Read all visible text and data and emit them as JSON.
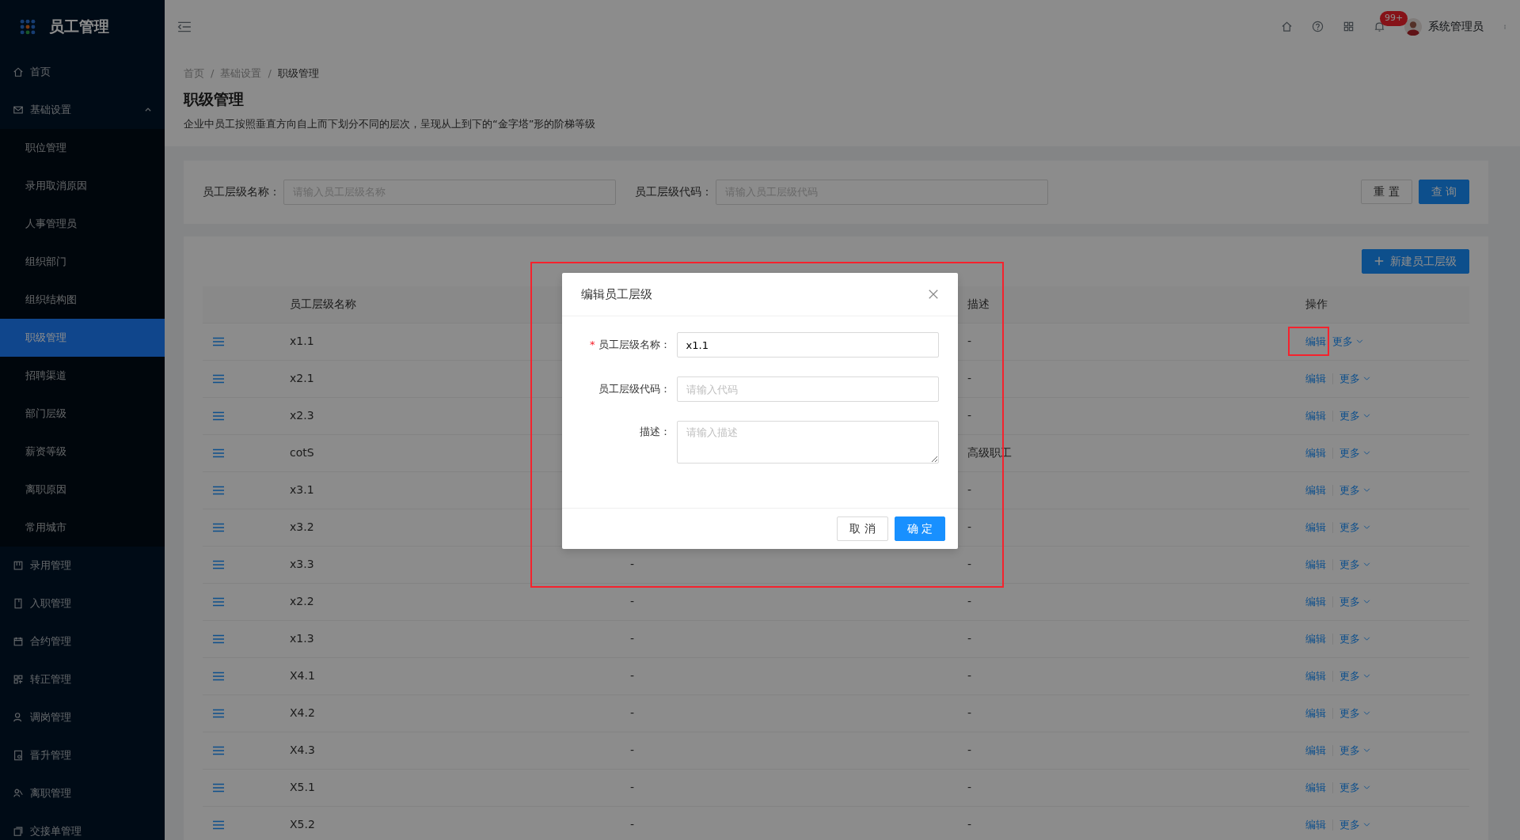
{
  "app": {
    "title": "员工管理"
  },
  "sidebar": {
    "items": [
      {
        "label": "首页",
        "kind": "link",
        "selected": false
      },
      {
        "label": "基础设置",
        "kind": "group",
        "expanded": true,
        "children": [
          {
            "label": "职位管理",
            "selected": false
          },
          {
            "label": "录用取消原因",
            "selected": false
          },
          {
            "label": "人事管理员",
            "selected": false
          },
          {
            "label": "组织部门",
            "selected": false
          },
          {
            "label": "组织结构图",
            "selected": false
          },
          {
            "label": "职级管理",
            "selected": true
          },
          {
            "label": "招聘渠道",
            "selected": false
          },
          {
            "label": "部门层级",
            "selected": false
          },
          {
            "label": "薪资等级",
            "selected": false
          },
          {
            "label": "离职原因",
            "selected": false
          },
          {
            "label": "常用城市",
            "selected": false
          }
        ]
      },
      {
        "label": "录用管理",
        "kind": "link",
        "selected": false
      },
      {
        "label": "入职管理",
        "kind": "link",
        "selected": false
      },
      {
        "label": "合约管理",
        "kind": "link",
        "selected": false
      },
      {
        "label": "转正管理",
        "kind": "link",
        "selected": false
      },
      {
        "label": "调岗管理",
        "kind": "link",
        "selected": false
      },
      {
        "label": "晋升管理",
        "kind": "link",
        "selected": false
      },
      {
        "label": "离职管理",
        "kind": "link",
        "selected": false
      },
      {
        "label": "交接单管理",
        "kind": "link",
        "selected": false
      }
    ]
  },
  "header": {
    "notification_badge": "99+",
    "user": "系统管理员"
  },
  "breadcrumb_separator": "/",
  "breadcrumb": [
    {
      "label": "首页",
      "selected": false
    },
    {
      "label": "基础设置",
      "selected": false
    },
    {
      "label": "职级管理",
      "selected": true
    }
  ],
  "page": {
    "title": "职级管理",
    "description": "企业中员工按照垂直方向自上而下划分不同的层次，呈现从上到下的“金字塔”形的阶梯等级"
  },
  "filters": [
    {
      "label": "员工层级名称：",
      "placeholder": "请输入员工层级名称"
    },
    {
      "label": "员工层级代码：",
      "placeholder": "请输入员工层级代码"
    }
  ],
  "filter_buttons": [
    {
      "label": "重 置",
      "kind": "default"
    },
    {
      "label": "查 询",
      "kind": "primary"
    }
  ],
  "new_button": {
    "label": "新建员工层级"
  },
  "table": {
    "columns": {
      "name": "员工层级名称",
      "description": "描述",
      "actions": "操作"
    },
    "rows": [
      {
        "name": "x1.1",
        "description": "-",
        "actions": [
          "编辑",
          "更多"
        ],
        "highlighted": true
      },
      {
        "name": "x2.1",
        "description": "-",
        "actions": [
          "编辑",
          "更多"
        ],
        "highlighted": false
      },
      {
        "name": "x2.3",
        "description": "-",
        "actions": [
          "编辑",
          "更多"
        ],
        "highlighted": false
      },
      {
        "name": "cotS",
        "description": "高级职工",
        "actions": [
          "编辑",
          "更多"
        ],
        "highlighted": false
      },
      {
        "name": "x3.1",
        "description": "-",
        "actions": [
          "编辑",
          "更多"
        ],
        "highlighted": false
      },
      {
        "name": "x3.2",
        "description": "-",
        "actions": [
          "编辑",
          "更多"
        ],
        "highlighted": false
      },
      {
        "name": "x3.3",
        "column_3": "-",
        "description": "-",
        "actions": [
          "编辑",
          "更多"
        ],
        "highlighted": false
      },
      {
        "name": "x2.2",
        "column_3": "-",
        "description": "-",
        "actions": [
          "编辑",
          "更多"
        ],
        "highlighted": false
      },
      {
        "name": "x1.3",
        "column_3": "-",
        "description": "-",
        "actions": [
          "编辑",
          "更多"
        ],
        "highlighted": false
      },
      {
        "name": "X4.1",
        "column_3": "-",
        "description": "-",
        "actions": [
          "编辑",
          "更多"
        ],
        "highlighted": false
      },
      {
        "name": "X4.2",
        "column_3": "-",
        "description": "-",
        "actions": [
          "编辑",
          "更多"
        ],
        "highlighted": false
      },
      {
        "name": "X4.3",
        "column_3": "-",
        "description": "-",
        "actions": [
          "编辑",
          "更多"
        ],
        "highlighted": false
      },
      {
        "name": "X5.1",
        "column_3": "-",
        "description": "-",
        "actions": [
          "编辑",
          "更多"
        ],
        "highlighted": false
      },
      {
        "name": "X5.2",
        "column_3": "-",
        "description": "-",
        "actions": [
          "编辑",
          "更多"
        ],
        "highlighted": false
      }
    ]
  },
  "dialog": {
    "title": "编辑员工层级",
    "highlighted": true,
    "required_mark": "*",
    "fields": [
      {
        "label": "员工层级名称：",
        "required": true,
        "kind": "input",
        "value": "x1.1"
      },
      {
        "label": "员工层级代码：",
        "required": false,
        "kind": "input",
        "placeholder": "请输入代码"
      },
      {
        "label": "描述：",
        "required": false,
        "kind": "textarea",
        "placeholder": "请输入描述"
      }
    ],
    "buttons": [
      {
        "label": "取 消",
        "kind": "default"
      },
      {
        "label": "确 定",
        "kind": "primary"
      }
    ]
  }
}
